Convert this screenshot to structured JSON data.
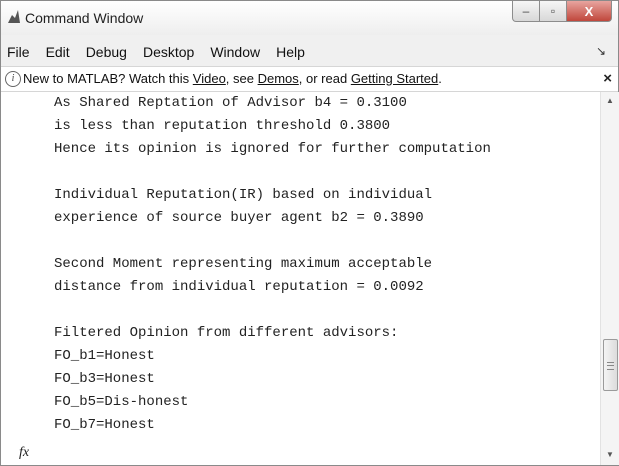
{
  "window": {
    "title": "Command Window",
    "controls": {
      "minimize": "–",
      "maximize": "▫",
      "close": "X"
    }
  },
  "menu": {
    "items": [
      "File",
      "Edit",
      "Debug",
      "Desktop",
      "Window",
      "Help"
    ],
    "overflow": "↘"
  },
  "info_bar": {
    "prefix": "New to MATLAB? Watch this ",
    "video_link": "Video",
    "mid1": ", see ",
    "demos_link": "Demos",
    "mid2": ", or read ",
    "getting_started_link": "Getting Started",
    "suffix": ".",
    "close": "×"
  },
  "console": {
    "lines": [
      "As Shared Reptation of Advisor b4 = 0.3100",
      "is less than reputation threshold 0.3800",
      "Hence its opinion is ignored for further computation",
      "",
      "Individual Reputation(IR) based on individual",
      "experience of source buyer agent b2 = 0.3890",
      "",
      "Second Moment representing maximum acceptable",
      "distance from individual reputation = 0.0092",
      "",
      "Filtered Opinion from different advisors:",
      "FO_b1=Honest",
      "FO_b3=Honest",
      "FO_b5=Dis-honest",
      "FO_b7=Honest"
    ],
    "prompt_symbol": "fx"
  },
  "scrollbar": {
    "position": 0.85
  }
}
